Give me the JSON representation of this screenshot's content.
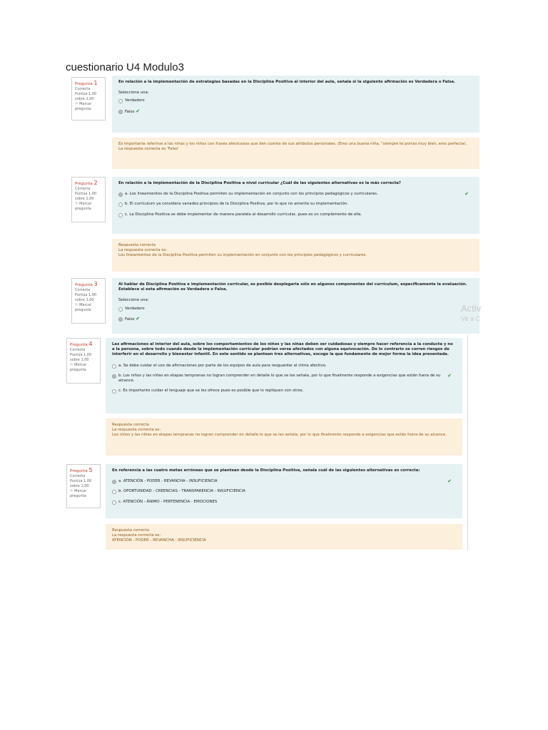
{
  "title": "cuestionario U4 Modulo3",
  "watermark": {
    "line1": "Activ",
    "line2": "Ve a C"
  },
  "questions": [
    {
      "label": "Pregunta",
      "number": "1",
      "status": "Correcta",
      "score_line1": "Puntúa 1,00",
      "score_line2": "sobre 1,00",
      "flag_line1": "Marcar",
      "flag_line2": "pregunta",
      "text": "En relación a la implementación de estrategias basadas en la Disciplina Positiva al interior del aula, señala si la siguiente afirmación es Verdadera o Falsa.",
      "prompt": "Seleccione una:",
      "options": [
        "Verdadero",
        "Falso"
      ],
      "feedback": [
        "Es importante referirse a las niñas y los niños con frases afectuosas que den cuenta de sus atributos personales. (Eres una buena niña, \"siempre te portas muy bien, eres perfecta).",
        "La respuesta correcta es 'Falso'"
      ]
    },
    {
      "label": "Pregunta",
      "number": "2",
      "status": "Correcta",
      "score_line1": "Puntúa 1,00",
      "score_line2": "sobre 1,00",
      "flag_line1": "Marcar",
      "flag_line2": "pregunta",
      "text": "En relación a la implementación de la Disciplina Positiva a nivel curricular ¿Cuál de las siguientes alternativas es la más correcta?",
      "prompt": "",
      "options": [
        "a. Los lineamientos de la Disciplina Positiva permiten su implementación en conjunto con los principios pedagógicos y curriculares.",
        "b. El currículum ya considera variados principios de la Disciplina Positiva, por lo que no amerita su implementación.",
        "c. La Disciplina Positiva se debe implementar de manera paralela al desarrollo curricular, pues es un complemento de ella."
      ],
      "feedback": [
        "Respuesta correcta",
        "La respuesta correcta es:",
        "Los lineamientos de la Disciplina Positiva permiten su implementación en conjunto con los principios pedagógicos y curriculares."
      ]
    },
    {
      "label": "Pregunta",
      "number": "3",
      "status": "Correcta",
      "score_line1": "Puntúa 1,00",
      "score_line2": "sobre 1,00",
      "flag_line1": "Marcar",
      "flag_line2": "pregunta",
      "text": "Al hablar de Disciplina Positiva e implementación curricular, es posible desplegarla sólo en algunos componentes del currículum, específicamente la evaluación. Establece si esta afirmación es Verdadera o Falsa.",
      "prompt": "Seleccione una:",
      "options": [
        "Verdadero",
        "Falso"
      ],
      "feedback": []
    },
    {
      "label": "Pregunta",
      "number": "4",
      "status": "Correcta",
      "score_line1": "Puntúa 1,00",
      "score_line2": "sobre 1,00",
      "flag_line1": "Marcar",
      "flag_line2": "pregunta",
      "text": "Las afirmaciones al interior del aula, sobre los comportamientos de los niños y las niñas deben ser cuidadosas y siempre hacer referencia a la conducta y no a la persona, sobre todo cuando desde la implementación curricular podrían verse afectados con alguna equivocación. De lo contrario se corren riesgos de interferir en el desarrollo y bienestar infantil. En este sentido se plantean tres alternativas, escoge la que fundamente de mejor forma la idea presentada.",
      "prompt": "",
      "options": [
        "a. Se debe cuidar el uso de afirmaciones por parte de los equipos de aula para resguardar el clima afectivo.",
        "b. Los niños y las niñas en etapas tempranas no logran comprender en detalle lo que se les señala, por lo que finalmente responde a exigencias que están fuera de su alcance.",
        "c. Es importante cuidar el lenguaje que se les ofrece pues es posible que lo repliquen con otros."
      ],
      "feedback": [
        "Respuesta correcta",
        "La respuesta correcta es:",
        "Los niños y las niñas en etapas tempranas no logran comprender en detalle lo que se les señala, por lo que finalmente responde a exigencias que están fuera de su alcance."
      ]
    },
    {
      "label": "Pregunta",
      "number": "5",
      "status": "Correcta",
      "score_line1": "Puntúa 1,00",
      "score_line2": "sobre 1,00",
      "flag_line1": "Marcar",
      "flag_line2": "pregunta",
      "text": "En referencia a las cuatro metas erróneas que se plantean desde la Disciplina Positiva, señala cuál de las siguientes alternativas es correcta:",
      "prompt": "",
      "options": [
        "a. ATENCIÓN - PODER - REVANCHA - INSUFICIENCIA",
        "b. OPORTUNIDAD - CREENCIAS - TRANSPARENCIA - INSUFICIENCIA",
        "c. ATENCIÓN - ÁNIMO - PERTENENCIA - EMOCIONES"
      ],
      "feedback": [
        "Respuesta correcta",
        "La respuesta correcta es:",
        "ATENCIÓN - PODER - REVANCHA - INSUFICIENCIA"
      ]
    }
  ],
  "check_symbol": "✔",
  "flag_symbol": "⚐"
}
